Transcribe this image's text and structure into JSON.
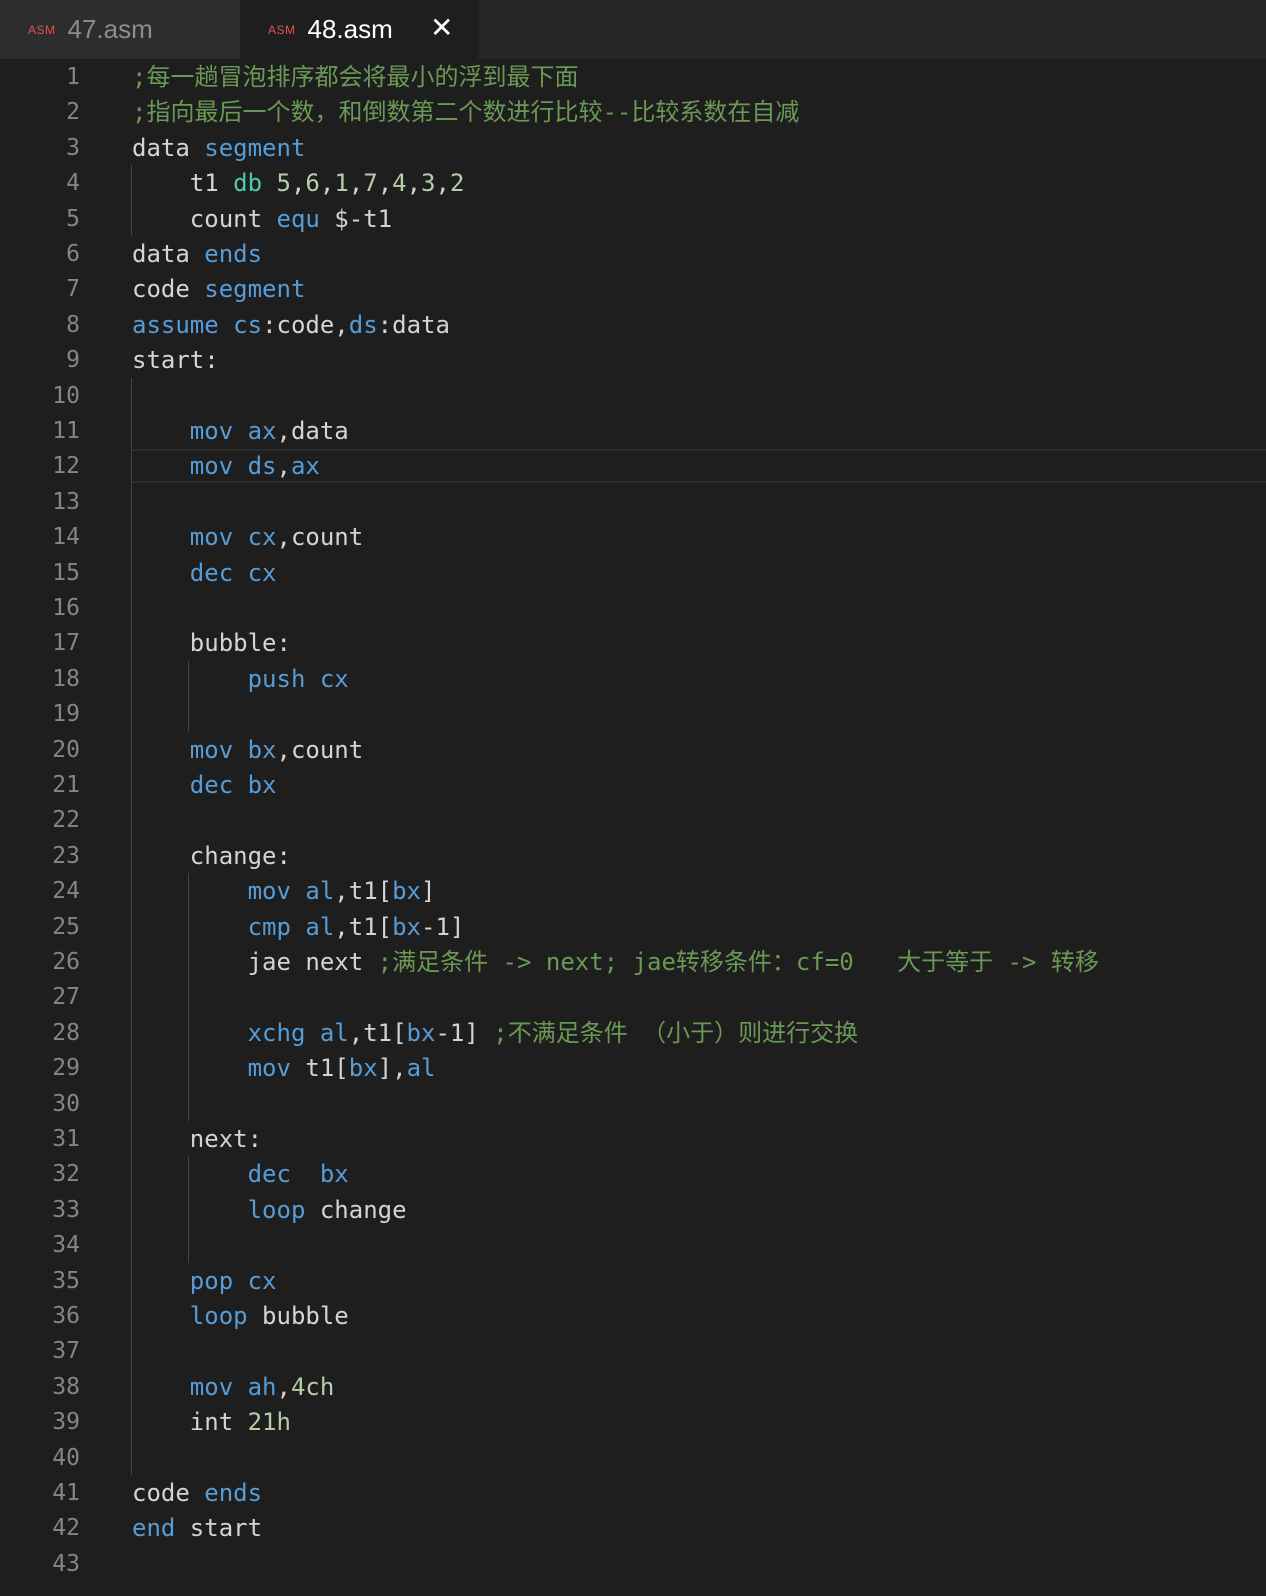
{
  "tabs": [
    {
      "lang": "ASM",
      "name": "47.asm",
      "active": false
    },
    {
      "lang": "ASM",
      "name": "48.asm",
      "active": true,
      "close": "✕"
    }
  ],
  "editor": {
    "cursor_line": 12,
    "lines": [
      {
        "n": "1",
        "indent": 0,
        "tokens": [
          [
            "cmt",
            ";每一趟冒泡排序都会将最小的浮到最下面"
          ]
        ]
      },
      {
        "n": "2",
        "indent": 0,
        "tokens": [
          [
            "cmt",
            ";指向最后一个数，和倒数第二个数进行比较--比较系数在自减"
          ]
        ]
      },
      {
        "n": "3",
        "indent": 0,
        "tokens": [
          [
            "id",
            "data "
          ],
          [
            "kw",
            "segment"
          ]
        ]
      },
      {
        "n": "4",
        "indent": 1,
        "tokens": [
          [
            "id",
            "t1 "
          ],
          [
            "db",
            "db "
          ],
          [
            "num",
            "5"
          ],
          [
            "id",
            ","
          ],
          [
            "num",
            "6"
          ],
          [
            "id",
            ","
          ],
          [
            "num",
            "1"
          ],
          [
            "id",
            ","
          ],
          [
            "num",
            "7"
          ],
          [
            "id",
            ","
          ],
          [
            "num",
            "4"
          ],
          [
            "id",
            ","
          ],
          [
            "num",
            "3"
          ],
          [
            "id",
            ","
          ],
          [
            "num",
            "2"
          ]
        ]
      },
      {
        "n": "5",
        "indent": 1,
        "tokens": [
          [
            "id",
            "count "
          ],
          [
            "kw",
            "equ"
          ],
          [
            "id",
            " $-t1"
          ]
        ]
      },
      {
        "n": "6",
        "indent": 0,
        "tokens": [
          [
            "id",
            "data "
          ],
          [
            "kw",
            "ends"
          ]
        ]
      },
      {
        "n": "7",
        "indent": 0,
        "tokens": [
          [
            "id",
            "code "
          ],
          [
            "kw",
            "segment"
          ]
        ]
      },
      {
        "n": "8",
        "indent": 0,
        "tokens": [
          [
            "kw",
            "assume "
          ],
          [
            "reg",
            "cs"
          ],
          [
            "id",
            ":code,"
          ],
          [
            "reg",
            "ds"
          ],
          [
            "id",
            ":data"
          ]
        ]
      },
      {
        "n": "9",
        "indent": 0,
        "tokens": [
          [
            "id",
            "start:"
          ]
        ]
      },
      {
        "n": "10",
        "indent": 0,
        "tokens": []
      },
      {
        "n": "11",
        "indent": 1,
        "tokens": [
          [
            "kw",
            "mov "
          ],
          [
            "reg",
            "ax"
          ],
          [
            "id",
            ",data"
          ]
        ]
      },
      {
        "n": "12",
        "indent": 1,
        "tokens": [
          [
            "kw",
            "mov "
          ],
          [
            "reg",
            "ds"
          ],
          [
            "id",
            ","
          ],
          [
            "reg",
            "ax"
          ]
        ]
      },
      {
        "n": "13",
        "indent": 0,
        "tokens": []
      },
      {
        "n": "14",
        "indent": 1,
        "tokens": [
          [
            "kw",
            "mov "
          ],
          [
            "reg",
            "cx"
          ],
          [
            "id",
            ",count"
          ]
        ]
      },
      {
        "n": "15",
        "indent": 1,
        "tokens": [
          [
            "kw",
            "dec "
          ],
          [
            "reg",
            "cx"
          ]
        ]
      },
      {
        "n": "16",
        "indent": 0,
        "tokens": []
      },
      {
        "n": "17",
        "indent": 1,
        "tokens": [
          [
            "id",
            "bubble:"
          ]
        ]
      },
      {
        "n": "18",
        "indent": 2,
        "tokens": [
          [
            "kw",
            "push "
          ],
          [
            "reg",
            "cx"
          ]
        ]
      },
      {
        "n": "19",
        "indent": 0,
        "tokens": []
      },
      {
        "n": "20",
        "indent": 1,
        "tokens": [
          [
            "kw",
            "mov "
          ],
          [
            "reg",
            "bx"
          ],
          [
            "id",
            ",count"
          ]
        ]
      },
      {
        "n": "21",
        "indent": 1,
        "tokens": [
          [
            "kw",
            "dec "
          ],
          [
            "reg",
            "bx"
          ]
        ]
      },
      {
        "n": "22",
        "indent": 0,
        "tokens": []
      },
      {
        "n": "23",
        "indent": 1,
        "tokens": [
          [
            "id",
            "change:"
          ]
        ]
      },
      {
        "n": "24",
        "indent": 2,
        "tokens": [
          [
            "kw",
            "mov "
          ],
          [
            "reg",
            "al"
          ],
          [
            "id",
            ",t1["
          ],
          [
            "reg",
            "bx"
          ],
          [
            "id",
            "]"
          ]
        ]
      },
      {
        "n": "25",
        "indent": 2,
        "tokens": [
          [
            "kw",
            "cmp "
          ],
          [
            "reg",
            "al"
          ],
          [
            "id",
            ",t1["
          ],
          [
            "reg",
            "bx"
          ],
          [
            "id",
            "-1]"
          ]
        ]
      },
      {
        "n": "26",
        "indent": 2,
        "tokens": [
          [
            "id",
            "jae next "
          ],
          [
            "cmt",
            ";满足条件 -> next; jae转移条件：cf=0   大于等于 -> 转移"
          ]
        ]
      },
      {
        "n": "27",
        "indent": 0,
        "tokens": []
      },
      {
        "n": "28",
        "indent": 2,
        "tokens": [
          [
            "kw",
            "xchg "
          ],
          [
            "reg",
            "al"
          ],
          [
            "id",
            ",t1["
          ],
          [
            "reg",
            "bx"
          ],
          [
            "id",
            "-1] "
          ],
          [
            "cmt",
            ";不满足条件 （小于）则进行交换"
          ]
        ]
      },
      {
        "n": "29",
        "indent": 2,
        "tokens": [
          [
            "kw",
            "mov "
          ],
          [
            "id",
            "t1["
          ],
          [
            "reg",
            "bx"
          ],
          [
            "id",
            "],"
          ],
          [
            "reg",
            "al"
          ]
        ]
      },
      {
        "n": "30",
        "indent": 0,
        "tokens": []
      },
      {
        "n": "31",
        "indent": 1,
        "tokens": [
          [
            "id",
            "next:"
          ]
        ]
      },
      {
        "n": "32",
        "indent": 2,
        "tokens": [
          [
            "kw",
            "dec  "
          ],
          [
            "reg",
            "bx"
          ]
        ]
      },
      {
        "n": "33",
        "indent": 2,
        "tokens": [
          [
            "kw",
            "loop "
          ],
          [
            "id",
            "change"
          ]
        ]
      },
      {
        "n": "34",
        "indent": 0,
        "tokens": []
      },
      {
        "n": "35",
        "indent": 1,
        "tokens": [
          [
            "kw",
            "pop "
          ],
          [
            "reg",
            "cx"
          ]
        ]
      },
      {
        "n": "36",
        "indent": 1,
        "tokens": [
          [
            "kw",
            "loop "
          ],
          [
            "id",
            "bubble"
          ]
        ]
      },
      {
        "n": "37",
        "indent": 0,
        "tokens": []
      },
      {
        "n": "38",
        "indent": 1,
        "tokens": [
          [
            "kw",
            "mov "
          ],
          [
            "reg",
            "ah"
          ],
          [
            "id",
            ","
          ],
          [
            "num",
            "4ch"
          ]
        ]
      },
      {
        "n": "39",
        "indent": 1,
        "tokens": [
          [
            "id",
            "int "
          ],
          [
            "num",
            "21h"
          ]
        ]
      },
      {
        "n": "40",
        "indent": 0,
        "tokens": []
      },
      {
        "n": "41",
        "indent": 0,
        "tokens": [
          [
            "id",
            "code "
          ],
          [
            "kw",
            "ends"
          ]
        ]
      },
      {
        "n": "42",
        "indent": 0,
        "tokens": [
          [
            "kw",
            "end "
          ],
          [
            "id",
            "start"
          ]
        ]
      },
      {
        "n": "43",
        "indent": 0,
        "tokens": []
      }
    ]
  }
}
